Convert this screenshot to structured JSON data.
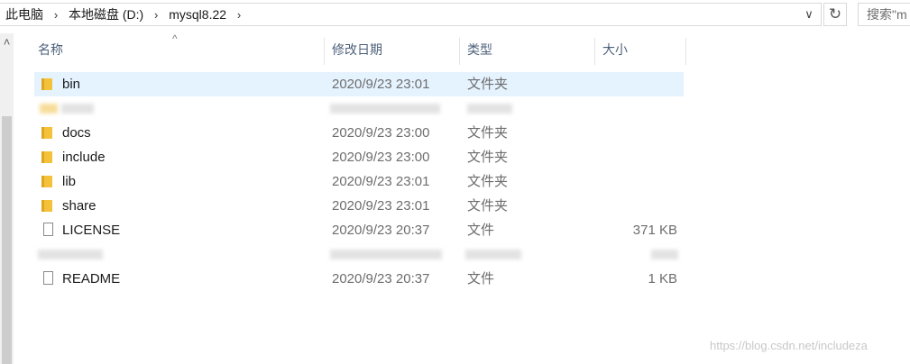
{
  "address": {
    "crumbs": [
      "此电脑",
      "本地磁盘 (D:)",
      "mysql8.22"
    ],
    "separator": "›",
    "dropdown_glyph": "∨",
    "refresh_glyph": "↻",
    "search_placeholder": "搜索\"m"
  },
  "header": {
    "name": "名称",
    "date": "修改日期",
    "type": "类型",
    "size": "大小",
    "sort_caret": "^"
  },
  "scrollbar": {
    "up_glyph": "˄"
  },
  "files": [
    {
      "name": "bin",
      "date": "2020/9/23 23:01",
      "type": "文件夹",
      "size": "",
      "icon": "folder-icon",
      "selected": true
    },
    {
      "name": "",
      "date": "",
      "type": "",
      "size": "",
      "icon": "blurred",
      "blurred": true
    },
    {
      "name": "docs",
      "date": "2020/9/23 23:00",
      "type": "文件夹",
      "size": "",
      "icon": "folder-icon"
    },
    {
      "name": "include",
      "date": "2020/9/23 23:00",
      "type": "文件夹",
      "size": "",
      "icon": "folder-icon"
    },
    {
      "name": "lib",
      "date": "2020/9/23 23:01",
      "type": "文件夹",
      "size": "",
      "icon": "folder-icon"
    },
    {
      "name": "share",
      "date": "2020/9/23 23:01",
      "type": "文件夹",
      "size": "",
      "icon": "folder-icon"
    },
    {
      "name": "LICENSE",
      "date": "2020/9/23 20:37",
      "type": "文件",
      "size": "371 KB",
      "icon": "file-icon"
    },
    {
      "name": "",
      "date": "",
      "type": "",
      "size": "",
      "icon": "blurred",
      "blurred": true
    },
    {
      "name": "README",
      "date": "2020/9/23 20:37",
      "type": "文件",
      "size": "1 KB",
      "icon": "file-icon"
    }
  ],
  "watermark": "https://blog.csdn.net/includeza"
}
